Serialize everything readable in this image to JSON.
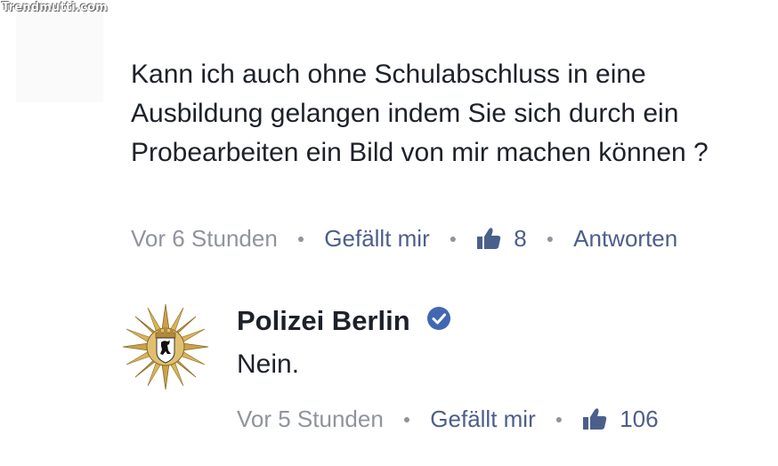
{
  "watermark": "Trendmutti.com",
  "comment": {
    "text": "Kann ich auch ohne Schulabschluss in eine Ausbildung gelangen indem Sie sich durch ein Probearbeiten ein Bild von mir machen können ?",
    "time": "Vor 6 Stunden",
    "like_label": "Gefällt mir",
    "like_count": "8",
    "reply_label": "Antworten"
  },
  "reply": {
    "author": "Polizei Berlin",
    "text": "Nein.",
    "time": "Vor 5 Stunden",
    "like_label": "Gefällt mir",
    "like_count": "106"
  },
  "colors": {
    "text": "#1d2129",
    "meta_gray": "#90949c",
    "link_blue": "#4b5f8b",
    "verified_blue": "#4267b2",
    "badge_gold": "#c9a24a"
  },
  "icons": [
    "thumbs-up-icon",
    "verified-badge-icon",
    "police-star-emblem"
  ]
}
